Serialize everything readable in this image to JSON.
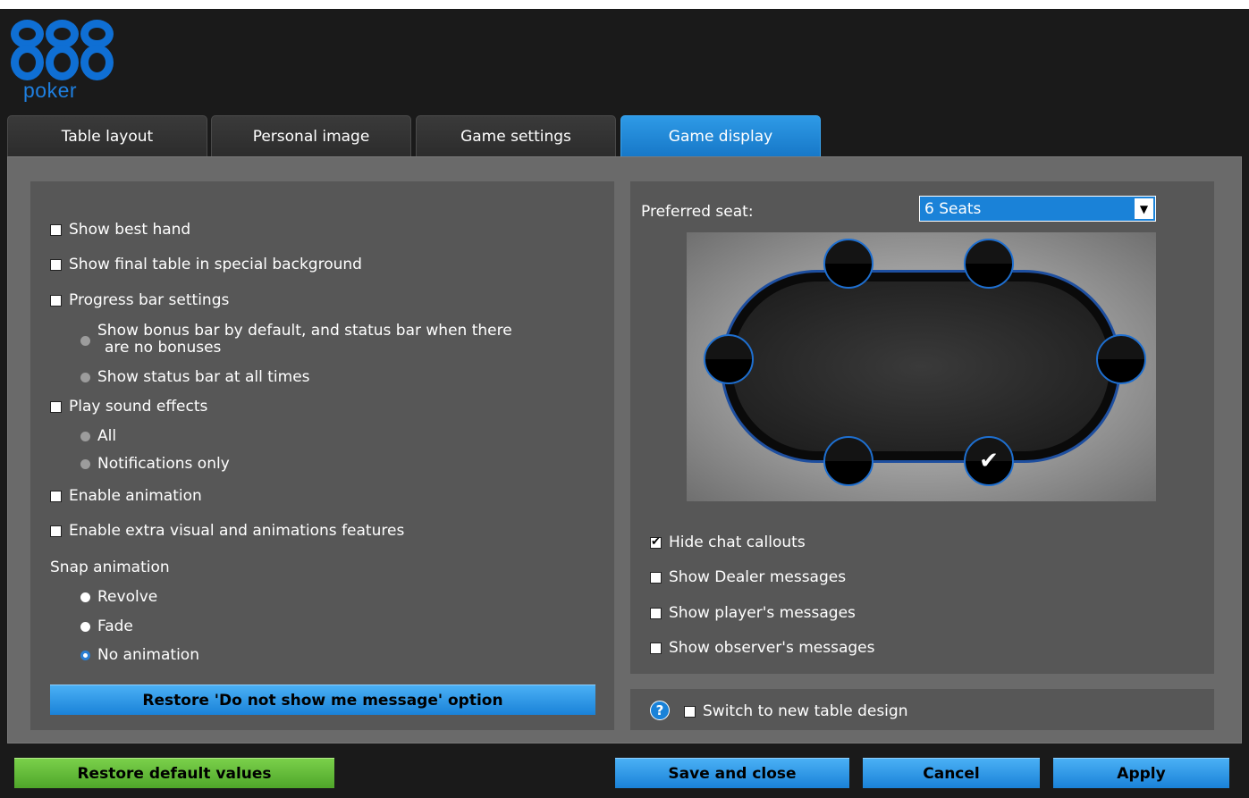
{
  "logo": {
    "number": "888",
    "word": "poker"
  },
  "tabs": [
    {
      "label": "Table layout",
      "active": false
    },
    {
      "label": "Personal image",
      "active": false
    },
    {
      "label": "Game settings",
      "active": false
    },
    {
      "label": "Game display",
      "active": true
    }
  ],
  "left": {
    "show_best_hand": {
      "label": "Show best hand",
      "checked": false
    },
    "show_final_table": {
      "label": "Show final table in special background",
      "checked": false
    },
    "progress_bar": {
      "label": "Progress bar settings",
      "checked": false
    },
    "progress_opt1_line1": "Show bonus bar by default, and status bar when there",
    "progress_opt1_line2": "are no bonuses",
    "progress_opt2": "Show status bar at all times",
    "sound": {
      "label": "Play sound effects",
      "checked": false
    },
    "sound_all": "All",
    "sound_notifications": "Notifications only",
    "enable_animation": {
      "label": "Enable animation",
      "checked": false
    },
    "enable_extra": {
      "label": "Enable extra visual and animations features",
      "checked": false
    },
    "snap_label": "Snap animation",
    "snap_revolve": "Revolve",
    "snap_fade": "Fade",
    "snap_none": "No animation",
    "snap_selected": "No animation",
    "restore_message_button": "Restore 'Do not show me message' option"
  },
  "right": {
    "preferred_seat_label": "Preferred seat:",
    "seats_select": "6 Seats",
    "selected_seat": 5,
    "hide_chat": {
      "label": "Hide chat callouts",
      "checked": true
    },
    "show_dealer": {
      "label": "Show Dealer messages",
      "checked": false
    },
    "show_player": {
      "label": "Show player's messages",
      "checked": false
    },
    "show_observer": {
      "label": "Show observer's messages",
      "checked": false
    },
    "switch_design": {
      "label": "Switch to new table design",
      "checked": false
    },
    "help_glyph": "?"
  },
  "footer": {
    "restore_defaults": "Restore default values",
    "save_close": "Save and close",
    "cancel": "Cancel",
    "apply": "Apply"
  },
  "colors": {
    "accent": "#1a82d8",
    "green": "#6cc83a",
    "panel": "#575757"
  }
}
